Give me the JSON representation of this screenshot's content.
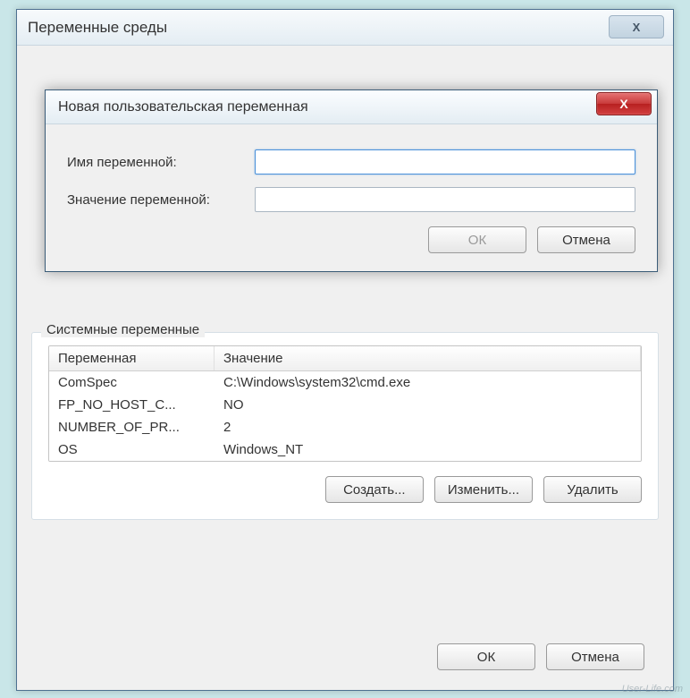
{
  "main_window": {
    "title": "Переменные среды",
    "close_glyph": "X"
  },
  "modal": {
    "title": "Новая пользовательская переменная",
    "close_glyph": "X",
    "name_label": "Имя переменной:",
    "value_label": "Значение переменной:",
    "name_value": "",
    "value_value": "",
    "ok_label": "ОК",
    "cancel_label": "Отмена"
  },
  "system_vars": {
    "legend": "Системные переменные",
    "columns": {
      "name": "Переменная",
      "value": "Значение"
    },
    "rows": [
      {
        "name": "ComSpec",
        "value": "C:\\Windows\\system32\\cmd.exe"
      },
      {
        "name": "FP_NO_HOST_C...",
        "value": "NO"
      },
      {
        "name": "NUMBER_OF_PR...",
        "value": "2"
      },
      {
        "name": "OS",
        "value": "Windows_NT"
      }
    ],
    "buttons": {
      "create": "Создать...",
      "edit": "Изменить...",
      "delete": "Удалить"
    }
  },
  "footer": {
    "ok": "ОК",
    "cancel": "Отмена"
  },
  "watermark": "User-Life.com"
}
